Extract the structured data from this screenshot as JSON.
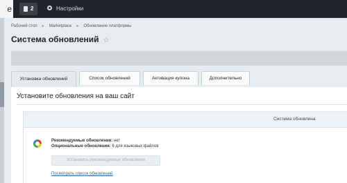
{
  "topbar": {
    "logo_fragment": "е",
    "notifications_count": "2",
    "settings_label": "Настройки"
  },
  "breadcrumb": [
    "Рабочий стол",
    "Marketplace",
    "Обновление платформы"
  ],
  "page_title": "Система обновлений",
  "tabs": [
    {
      "label": "Установка обновлений",
      "active": true
    },
    {
      "label": "Список обновлений",
      "active": false
    },
    {
      "label": "Активация купона",
      "active": false
    },
    {
      "label": "Дополнительно",
      "active": false
    }
  ],
  "content": {
    "section_title": "Установите обновления на ваш сайт",
    "system_header": "Система обновлена",
    "recommended_label": "Рекомендуемые обновления:",
    "recommended_value": "нет",
    "optional_label": "Опциональные обновления:",
    "optional_value": "6 для языковых файлов",
    "install_button": "Установить рекомендуемые обновления",
    "view_link": "Посмотреть список обновлений"
  },
  "colors": {
    "topbar_bg": "#21252b",
    "link": "#2067b0",
    "page_bg": "#e9ecee"
  }
}
